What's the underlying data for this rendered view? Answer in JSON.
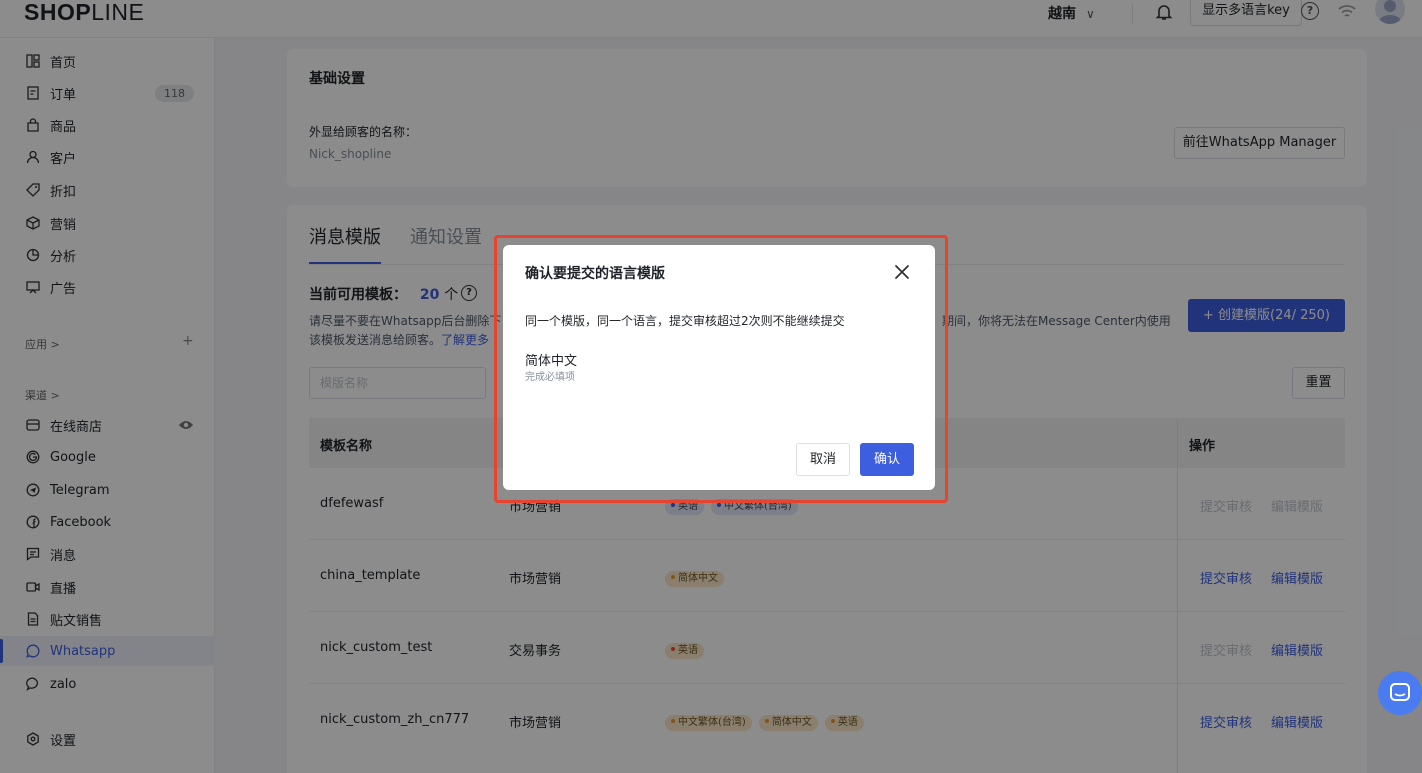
{
  "topbar": {
    "logo_left": "SHOP",
    "logo_right": "LINE",
    "region": "越南",
    "region_chev": "∨",
    "lang_key": "显示多语言key",
    "help": "?"
  },
  "sidebar": {
    "items": [
      {
        "label": "首页",
        "icon": "home-icon"
      },
      {
        "label": "订单",
        "icon": "order-icon",
        "badge": "118"
      },
      {
        "label": "商品",
        "icon": "product-bag-icon"
      },
      {
        "label": "客户",
        "icon": "customer-icon"
      },
      {
        "label": "折扣",
        "icon": "discount-tag-icon"
      },
      {
        "label": "营销",
        "icon": "marketing-box-icon"
      },
      {
        "label": "分析",
        "icon": "analytics-pie-icon"
      },
      {
        "label": "广告",
        "icon": "ads-icon"
      }
    ],
    "apps_label": "应用 >",
    "apps_plus": "+",
    "channels_label": "渠道 >",
    "channels": [
      {
        "label": "在线商店",
        "icon": "online-store-icon"
      },
      {
        "label": "Google",
        "icon": "google-icon"
      },
      {
        "label": "Telegram",
        "icon": "telegram-icon"
      },
      {
        "label": "Facebook",
        "icon": "facebook-icon"
      },
      {
        "label": "消息",
        "icon": "message-icon"
      },
      {
        "label": "直播",
        "icon": "live-icon"
      },
      {
        "label": "贴文销售",
        "icon": "post-sales-icon"
      },
      {
        "label": "Whatsapp",
        "icon": "whatsapp-icon"
      },
      {
        "label": "zalo",
        "icon": "zalo-icon"
      }
    ],
    "settings_label": "设置"
  },
  "basic": {
    "title": "基础设置",
    "name_label": "外显给顾客的名称：",
    "name_value": "Nick_shopline",
    "manager_button": "前往WhatsApp Manager"
  },
  "templates": {
    "tabs": [
      "消息模版",
      "通知设置"
    ],
    "available_label": "当前可用模板：",
    "available_count": "20",
    "available_unit": "个",
    "notice_line1": "请尽量不要在Whatsapp后台删除下",
    "notice_tail1": "期间，你将无法在Message Center内使用",
    "notice_line2": "该模板发送消息给顾客。",
    "learn_more": "了解更多",
    "create_button": "+ 创建模版(24/ 250)",
    "search_placeholder": "模版名称",
    "reset_button": "重置",
    "columns": [
      "模板名称",
      "操作"
    ],
    "rows": [
      {
        "name": "dfefewasf",
        "type": "市场营销",
        "tags": [
          {
            "text": "英语",
            "style": "blue"
          },
          {
            "text": "中文繁体(台湾)",
            "style": "blue"
          }
        ],
        "submit": "提交审核",
        "edit": "编辑模版",
        "enabled": false
      },
      {
        "name": "china_template",
        "type": "市场营销",
        "tags": [
          {
            "text": "简体中文",
            "style": "orange"
          }
        ],
        "submit": "提交审核",
        "edit": "编辑模版",
        "enabled": true
      },
      {
        "name": "nick_custom_test",
        "type": "交易事务",
        "tags": [
          {
            "text": "英语",
            "style": "red"
          }
        ],
        "submit": "提交审核",
        "edit": "编辑模版",
        "enabled": false
      },
      {
        "name": "nick_custom_zh_cn777",
        "type": "市场营销",
        "tags": [
          {
            "text": "中文繁体(台湾)",
            "style": "orange"
          },
          {
            "text": "简体中文",
            "style": "orange"
          },
          {
            "text": "英语",
            "style": "orange"
          }
        ],
        "submit": "提交审核",
        "edit": "编辑模版",
        "enabled": true
      }
    ]
  },
  "modal": {
    "title": "确认要提交的语言模版",
    "message": "同一个模版，同一个语言，提交审核超过2次则不能继续提交",
    "language": "简体中文",
    "required_hint": "完成必填项",
    "cancel": "取消",
    "confirm": "确认"
  },
  "colors": {
    "primary": "#3d5ede",
    "highlight": "#e8432f",
    "chat": "#4a7bef"
  }
}
